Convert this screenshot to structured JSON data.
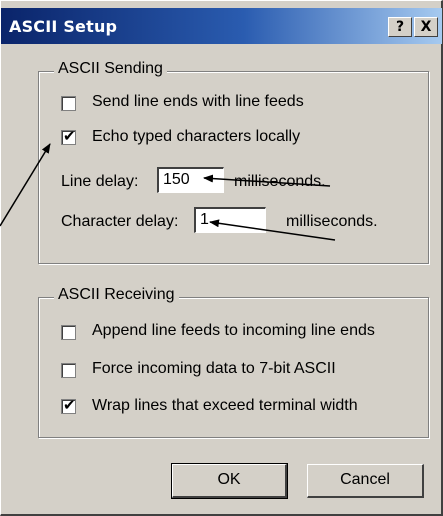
{
  "dialog": {
    "title": "ASCII Setup",
    "help_button": "?",
    "close_button": "X"
  },
  "sending": {
    "legend": "ASCII Sending",
    "send_line_ends": {
      "label": "Send line ends with line feeds",
      "checked": false
    },
    "echo_typed": {
      "label": "Echo typed characters locally",
      "checked": true
    },
    "line_delay": {
      "label": "Line delay:",
      "value": "150",
      "unit": "milliseconds."
    },
    "character_delay": {
      "label": "Character delay:",
      "value": "1",
      "unit": "milliseconds."
    }
  },
  "receiving": {
    "legend": "ASCII Receiving",
    "append_line_feeds": {
      "label": "Append line feeds to incoming line ends",
      "checked": false
    },
    "force_7bit": {
      "label": "Force incoming data to 7-bit ASCII",
      "checked": false
    },
    "wrap_lines": {
      "label": "Wrap lines that exceed terminal width",
      "checked": true
    }
  },
  "buttons": {
    "ok": "OK",
    "cancel": "Cancel"
  },
  "check_glyph": "✔",
  "colors": {
    "title_bar_start": "#0a246a",
    "title_bar_end": "#a6caf0",
    "dialog_face": "#d4d0c8"
  }
}
